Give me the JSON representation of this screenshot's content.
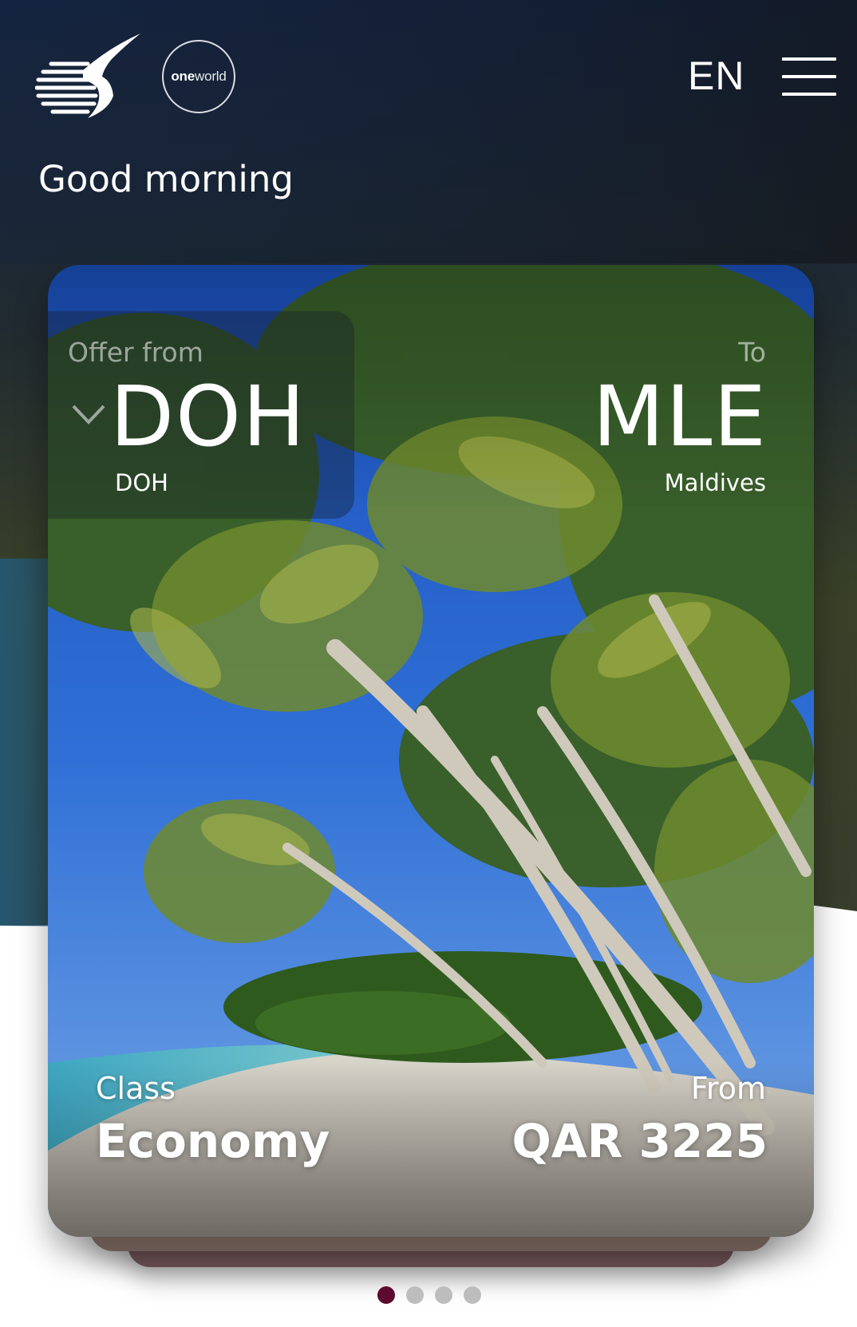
{
  "header": {
    "airline_logo_icon": "oryx-logo-icon",
    "alliance_badge": {
      "brand_bold": "one",
      "brand_light": "world"
    },
    "language": "EN",
    "menu_icon": "hamburger-menu-icon"
  },
  "greeting": "Good morning",
  "offer_card": {
    "origin_label": "Offer from",
    "origin_code": "DOH",
    "origin_name": "DOH",
    "destination_label": "To",
    "destination_code": "MLE",
    "destination_name": "Maldives",
    "class_label": "Class",
    "class_value": "Economy",
    "price_label": "From",
    "price_value": "QAR 3225",
    "dropdown_icon": "chevron-down-icon"
  },
  "carousel": {
    "pages": 4,
    "active_index": 0
  },
  "colors": {
    "header_top": "#15243f",
    "header_olive": "#3a4128",
    "active_dot": "#5c0a2e",
    "inactive_dot": "#bdbdbd"
  }
}
